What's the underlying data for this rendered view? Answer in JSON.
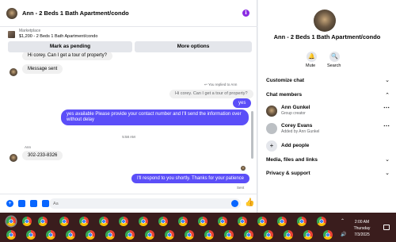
{
  "chat": {
    "title": "Ann - 2 Beds 1 Bath Apartment/condo",
    "marketplace_label": "Marketplace",
    "listing": "$1,200 - 2 Beds 1 Bath Apartment/condo",
    "mark_pending_label": "Mark as pending",
    "more_options_label": "More options",
    "messages": {
      "m1": "Hi corey.  Can I get a tour of property?",
      "m2": "Message sent",
      "replied_note": "You replied to Ann",
      "m3": "Hi corey.  Can I get a tour of property?",
      "m4": "yes",
      "m5": "yes available Please provide your contact number and I'll send the information over without delay",
      "timestamp": "5:58 AM",
      "sender_name": "Ann",
      "m6": "302-233-8326",
      "m7": "I'll respond to you shortly. Thanks for your patience",
      "sent_status": "Sent"
    },
    "input_value": "Aa"
  },
  "panel": {
    "title": "Ann - 2 Beds 1 Bath Apartment/condo",
    "mute_label": "Mute",
    "search_label": "Search",
    "customize_chat": "Customize chat",
    "chat_members": "Chat members",
    "members": [
      {
        "name": "Ann Gunkel",
        "sub": "Group creator"
      },
      {
        "name": "Corey Evans",
        "sub": "Added by Ann Gunkel"
      }
    ],
    "add_people": "Add people",
    "media_files_links": "Media, files and links",
    "privacy_support": "Privacy & support"
  },
  "taskbar": {
    "time": "2:00 AM",
    "day": "Thursday",
    "date": "7/3/2025"
  },
  "colors": {
    "accent": "#5b4ef8",
    "messenger_blue": "#0866ff",
    "taskbar": "#3a1d1d"
  }
}
